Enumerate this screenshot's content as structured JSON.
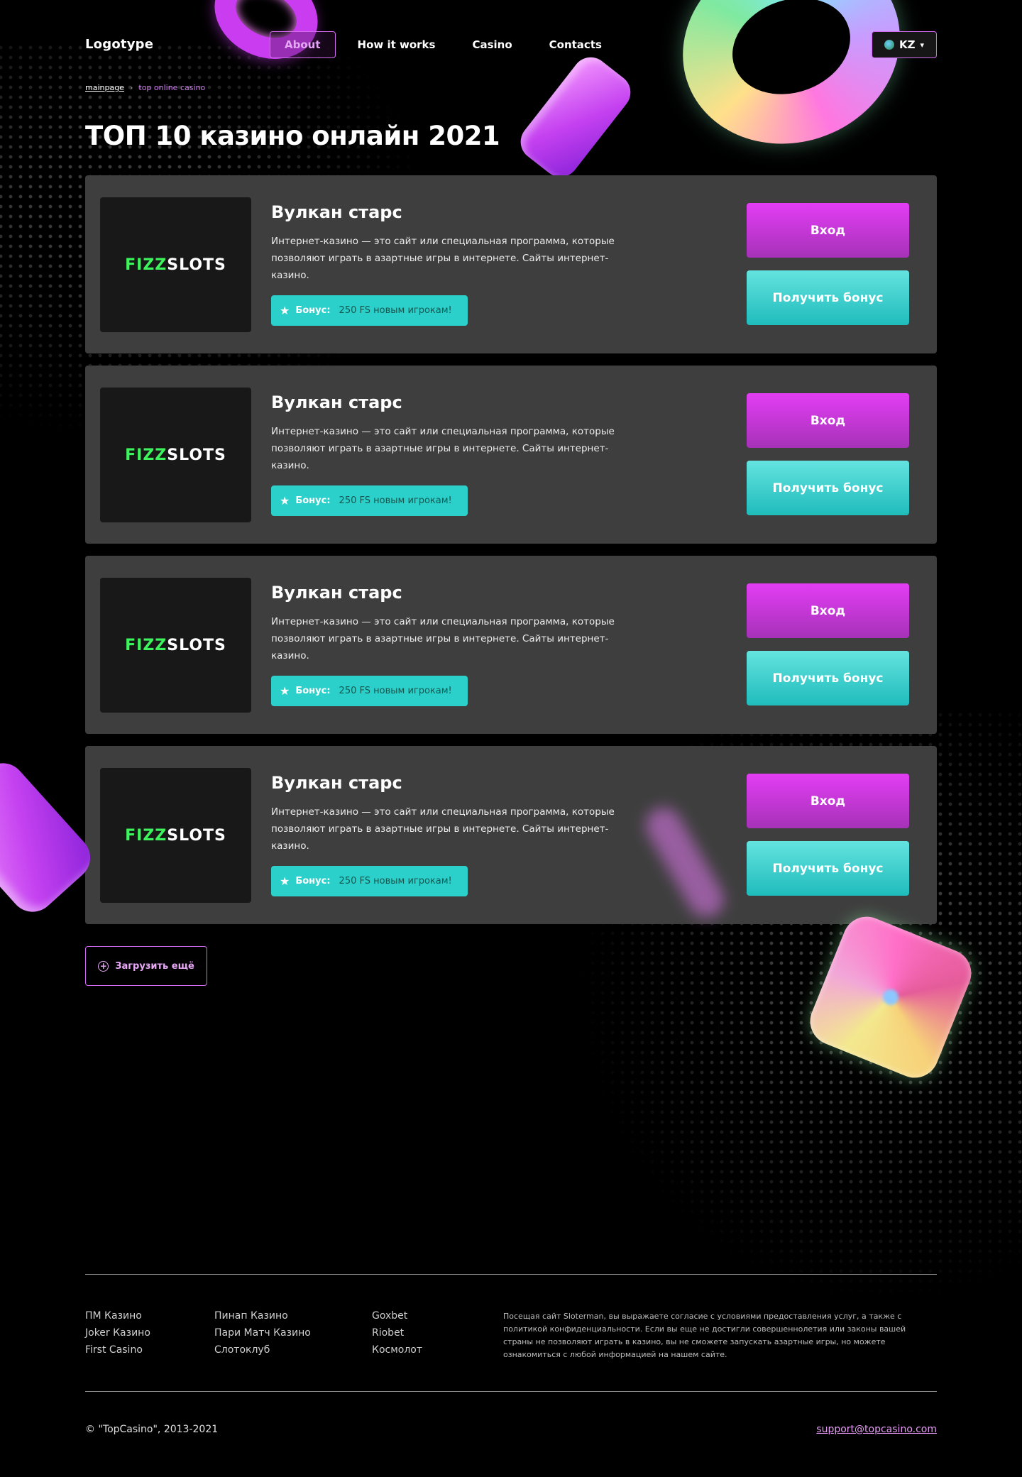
{
  "header": {
    "logo": "Logotype",
    "nav": [
      {
        "label": "About",
        "active": true
      },
      {
        "label": "How it works",
        "active": false
      },
      {
        "label": "Casino",
        "active": false
      },
      {
        "label": "Contacts",
        "active": false
      }
    ],
    "language": "KZ"
  },
  "breadcrumb": {
    "home": "mainpage",
    "separator": "›",
    "current": "top online casino"
  },
  "page_title": "ТОП 10 казино онлайн 2021",
  "casinos": [
    {
      "logo_part1": "FIZZ",
      "logo_part2": "SLOTS",
      "name": "Вулкан старс",
      "description": "Интернет-казино — это сайт или специальная программа, которые позволяют играть в азартные игры в интернете. Сайты интернет-казино.",
      "bonus_label": "Бонус:",
      "bonus_value": "250 FS новым игрокам!",
      "enter_label": "Вход",
      "bonus_button_label": "Получить бонус"
    },
    {
      "logo_part1": "FIZZ",
      "logo_part2": "SLOTS",
      "name": "Вулкан старс",
      "description": "Интернет-казино — это сайт или специальная программа, которые позволяют играть в азартные игры в интернете. Сайты интернет-казино.",
      "bonus_label": "Бонус:",
      "bonus_value": "250 FS новым игрокам!",
      "enter_label": "Вход",
      "bonus_button_label": "Получить бонус"
    },
    {
      "logo_part1": "FIZZ",
      "logo_part2": "SLOTS",
      "name": "Вулкан старс",
      "description": "Интернет-казино — это сайт или специальная программа, которые позволяют играть в азартные игры в интернете. Сайты интернет-казино.",
      "bonus_label": "Бонус:",
      "bonus_value": "250 FS новым игрокам!",
      "enter_label": "Вход",
      "bonus_button_label": "Получить бонус"
    },
    {
      "logo_part1": "FIZZ",
      "logo_part2": "SLOTS",
      "name": "Вулкан старс",
      "description": "Интернет-казино — это сайт или специальная программа, которые позволяют играть в азартные игры в интернете. Сайты интернет-казино.",
      "bonus_label": "Бонус:",
      "bonus_value": "250 FS новым игрокам!",
      "enter_label": "Вход",
      "bonus_button_label": "Получить бонус"
    }
  ],
  "load_more": "Загрузить ещё",
  "footer": {
    "columns": [
      [
        "ПМ Казино",
        "Joker Казино",
        "First Casino"
      ],
      [
        "Пинап Казино",
        "Пари Матч Казино",
        "Слотоклуб"
      ],
      [
        "Goxbet",
        "Riobet",
        "Космолот"
      ]
    ],
    "disclaimer": "Посещая сайт Sloterman, вы выражаете согласие с условиями предоставления услуг, а также с политикой конфиденциальности. Если вы еще не достигли совершеннолетия или законы вашей страны не позволяют играть в казино, вы не сможете запускать азартные игры, но можете ознакомиться с любой информацией на нашем сайте.",
    "copyright": "© \"TopCasino\", 2013-2021",
    "support_email": "support@topcasino.com"
  },
  "icons": {
    "language": "globe-icon",
    "language_toggle": "chevron-down-icon",
    "bonus": "star-icon",
    "load_more": "plus-circle-icon"
  },
  "colors": {
    "accent_pink": "#d46cf0",
    "enter_button": "#e33df4",
    "bonus_teal": "#2bd0cb",
    "card_bg": "#3e3e3e",
    "logo_green": "#3cf55c"
  }
}
